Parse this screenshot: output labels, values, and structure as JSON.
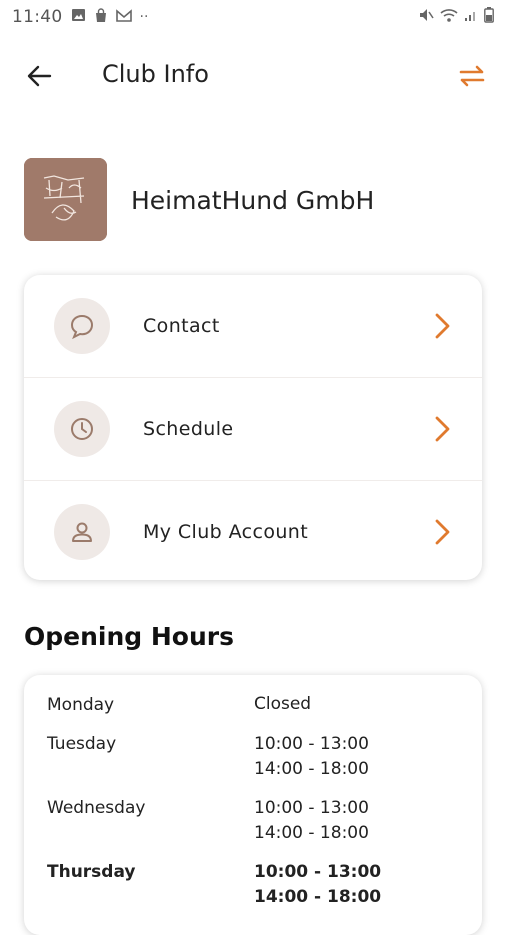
{
  "status_bar": {
    "time": "11:40",
    "dots": "··"
  },
  "header": {
    "title": "Club Info"
  },
  "club": {
    "name": "HeimatHund GmbH"
  },
  "menu": [
    {
      "label": "Contact",
      "icon": "chat-bubble-icon"
    },
    {
      "label": "Schedule",
      "icon": "clock-icon"
    },
    {
      "label": "My Club Account",
      "icon": "person-icon"
    }
  ],
  "opening_hours": {
    "title": "Opening Hours",
    "days": [
      {
        "day": "Monday",
        "times": [
          "Closed"
        ]
      },
      {
        "day": "Tuesday",
        "times": [
          "10:00 - 13:00",
          "14:00 - 18:00"
        ]
      },
      {
        "day": "Wednesday",
        "times": [
          "10:00 - 13:00",
          "14:00 - 18:00"
        ]
      },
      {
        "day": "Thursday",
        "times": [
          "10:00 - 13:00",
          "14:00 - 18:00"
        ]
      }
    ]
  },
  "colors": {
    "accent": "#e07a2e",
    "icon_bg": "#efe9e6",
    "icon_fg": "#9b7b6b",
    "logo_bg": "#a07a6a"
  }
}
